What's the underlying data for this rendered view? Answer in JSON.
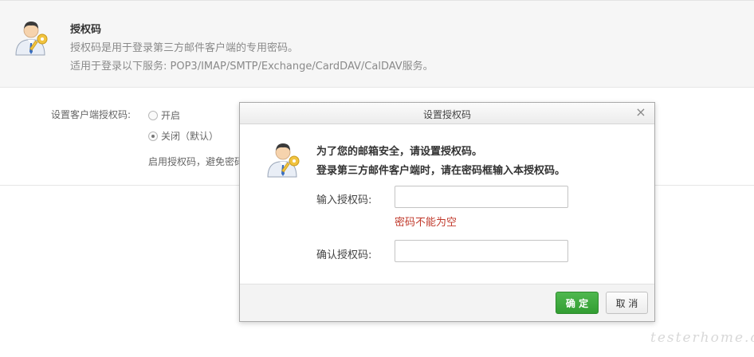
{
  "header": {
    "title": "授权码",
    "line1": "授权码是用于登录第三方邮件客户端的专用密码。",
    "line2": "适用于登录以下服务: POP3/IMAP/SMTP/Exchange/CardDAV/CalDAV服务。"
  },
  "settings": {
    "label": "设置客户端授权码:",
    "option_on": "开启",
    "option_off": "关闭（默认）",
    "selected": "off",
    "note": "启用授权码，避免密码泄露"
  },
  "dialog": {
    "title": "设置授权码",
    "close_glyph": "×",
    "message1": "为了您的邮箱安全，请设置授权码。",
    "message2": "登录第三方邮件客户端时，请在密码框输入本授权码。",
    "input_label": "输入授权码:",
    "input_value": "",
    "error_text": "密码不能为空",
    "confirm_label": "确认授权码:",
    "confirm_value": "",
    "ok_button": "确 定",
    "cancel_button": "取 消"
  },
  "colors": {
    "accent_green": "#3aa53a",
    "error_red": "#c0392b"
  },
  "watermark": "testerhome.com"
}
